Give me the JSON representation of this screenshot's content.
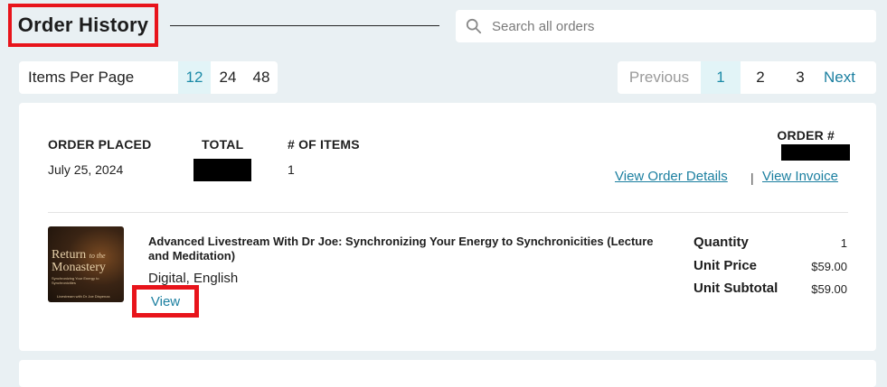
{
  "header": {
    "title": "Order History",
    "search_placeholder": "Search all orders"
  },
  "items_per_page": {
    "label": "Items Per Page",
    "options": [
      "12",
      "24",
      "48"
    ],
    "selected": "12"
  },
  "pagination": {
    "previous": "Previous",
    "pages": [
      "1",
      "2",
      "3"
    ],
    "current": "1",
    "next": "Next"
  },
  "order": {
    "placed_label": "ORDER PLACED",
    "placed_value": "July 25, 2024",
    "total_label": "TOTAL",
    "items_label": "# OF ITEMS",
    "items_value": "1",
    "order_num_label": "ORDER #",
    "view_details": "View Order Details",
    "separator": "|",
    "view_invoice": "View Invoice",
    "product": {
      "thumb_title_1": "Return",
      "thumb_title_small": "to the",
      "thumb_title_2": "Monastery",
      "thumb_subtitle": "Synchronizing Your Energy to Synchronicities",
      "thumb_footer": "Livestream with Dr Joe Dispenza",
      "name": "Advanced Livestream With Dr Joe: Synchronizing Your Energy to Synchronicities (Lecture and Meditation)",
      "format": "Digital, English",
      "view_label": "View",
      "quantity_label": "Quantity",
      "quantity_value": "1",
      "unit_price_label": "Unit Price",
      "unit_price_value": "$59.00",
      "unit_subtotal_label": "Unit Subtotal",
      "unit_subtotal_value": "$59.00"
    }
  },
  "colors": {
    "accent_red": "#e8141b",
    "link": "#1b7fa0",
    "background": "#e9f0f3"
  }
}
